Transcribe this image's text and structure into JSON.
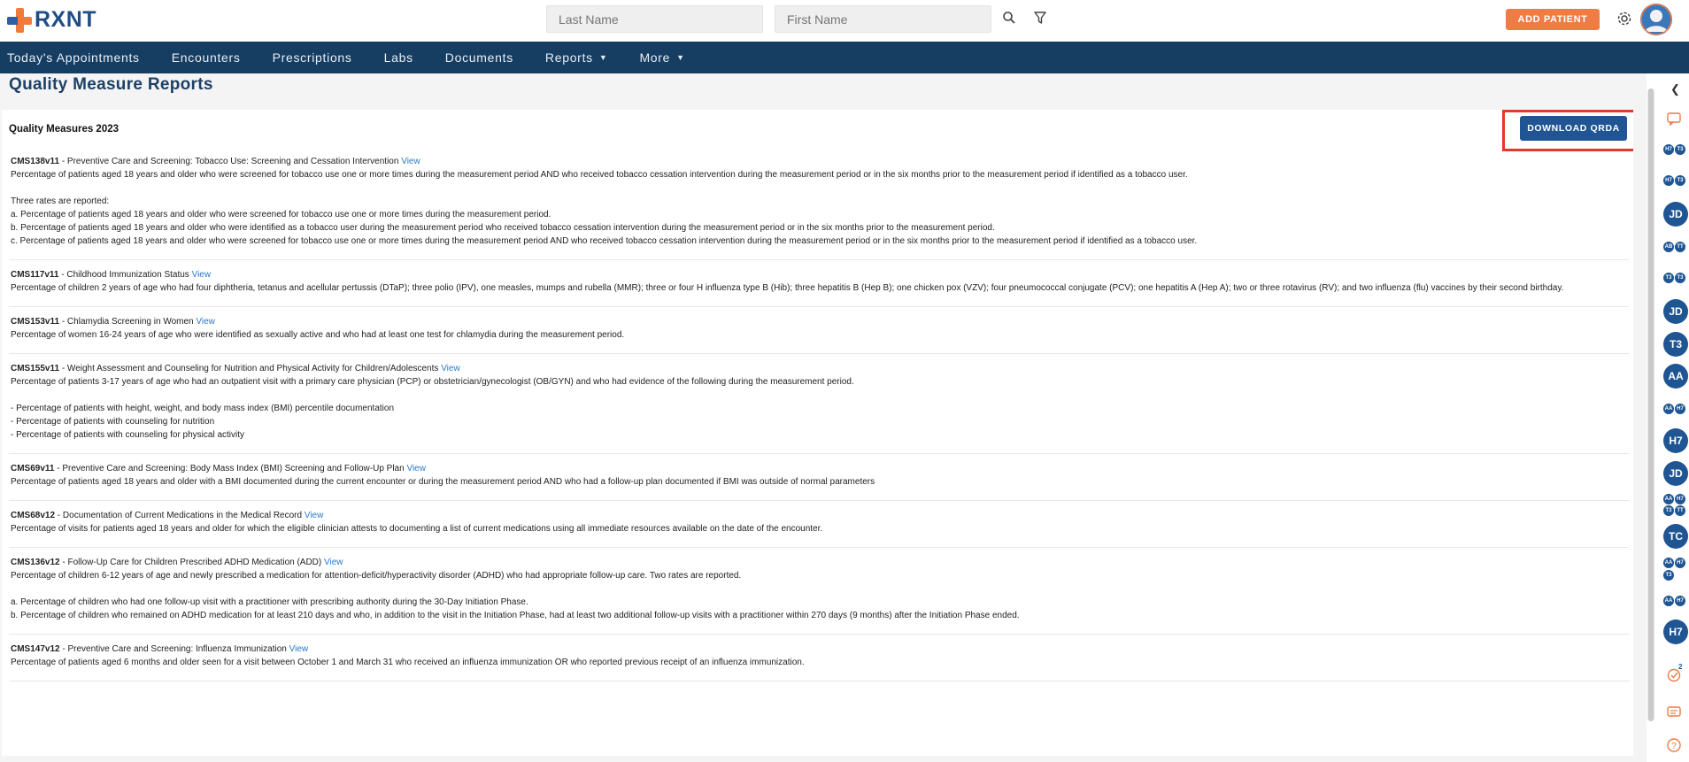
{
  "brand": {
    "name": "RXNT"
  },
  "header": {
    "last_name_placeholder": "Last Name",
    "first_name_placeholder": "First Name",
    "add_patient_label": "ADD PATIENT"
  },
  "nav": {
    "items": [
      {
        "label": "Today's Appointments"
      },
      {
        "label": "Encounters"
      },
      {
        "label": "Prescriptions"
      },
      {
        "label": "Labs"
      },
      {
        "label": "Documents"
      },
      {
        "label": "Reports"
      },
      {
        "label": "More"
      }
    ]
  },
  "page": {
    "title": "Quality Measure Reports",
    "section_title": "Quality Measures 2023",
    "download_label": "DOWNLOAD QRDA"
  },
  "measures": [
    {
      "code": "CMS138v11",
      "name": " - Preventive Care and Screening: Tobacco Use: Screening and Cessation Intervention ",
      "view": "View",
      "lines": [
        "Percentage of patients aged 18 years and older who were screened for tobacco use one or more times during the measurement period AND who received tobacco cessation intervention during the measurement period or in the six months prior to the measurement period if identified as a tobacco user.",
        "",
        "Three rates are reported:",
        "a. Percentage of patients aged 18 years and older who were screened for tobacco use one or more times during the measurement period.",
        "b. Percentage of patients aged 18 years and older who were identified as a tobacco user during the measurement period who received tobacco cessation intervention during the measurement period or in the six months prior to the measurement period.",
        "c. Percentage of patients aged 18 years and older who were screened for tobacco use one or more times during the measurement period AND who received tobacco cessation intervention during the measurement period or in the six months prior to the measurement period if identified as a tobacco user."
      ]
    },
    {
      "code": "CMS117v11",
      "name": " - Childhood Immunization Status ",
      "view": "View",
      "lines": [
        "Percentage of children 2 years of age who had four diphtheria, tetanus and acellular pertussis (DTaP); three polio (IPV), one measles, mumps and rubella (MMR); three or four H influenza type B (Hib); three hepatitis B (Hep B); one chicken pox (VZV); four pneumococcal conjugate (PCV); one hepatitis A (Hep A); two or three rotavirus (RV); and two influenza (flu) vaccines by their second birthday."
      ]
    },
    {
      "code": "CMS153v11",
      "name": " - Chlamydia Screening in Women ",
      "view": "View",
      "lines": [
        "Percentage of women 16-24 years of age who were identified as sexually active and who had at least one test for chlamydia during the measurement period."
      ]
    },
    {
      "code": "CMS155v11",
      "name": " - Weight Assessment and Counseling for Nutrition and Physical Activity for Children/Adolescents ",
      "view": "View",
      "lines": [
        "Percentage of patients 3-17 years of age who had an outpatient visit with a primary care physician (PCP) or obstetrician/gynecologist (OB/GYN) and who had evidence of the following during the measurement period.",
        "",
        "- Percentage of patients with height, weight, and body mass index (BMI) percentile documentation",
        "- Percentage of patients with counseling for nutrition",
        "- Percentage of patients with counseling for physical activity"
      ]
    },
    {
      "code": "CMS69v11",
      "name": " - Preventive Care and Screening: Body Mass Index (BMI) Screening and Follow-Up Plan ",
      "view": "View",
      "lines": [
        "Percentage of patients aged 18 years and older with a BMI documented during the current encounter or during the measurement period AND who had a follow-up plan documented if BMI was outside of normal parameters"
      ]
    },
    {
      "code": "CMS68v12",
      "name": " - Documentation of Current Medications in the Medical Record ",
      "view": "View",
      "lines": [
        "Percentage of visits for patients aged 18 years and older for which the eligible clinician attests to documenting a list of current medications using all immediate resources available on the date of the encounter."
      ]
    },
    {
      "code": "CMS136v12",
      "name": " - Follow-Up Care for Children Prescribed ADHD Medication (ADD) ",
      "view": "View",
      "lines": [
        "Percentage of children 6-12 years of age and newly prescribed a medication for attention-deficit/hyperactivity disorder (ADHD) who had appropriate follow-up care. Two rates are reported.",
        "",
        "a. Percentage of children who had one follow-up visit with a practitioner with prescribing authority during the 30-Day Initiation Phase.",
        "b. Percentage of children who remained on ADHD medication for at least 210 days and who, in addition to the visit in the Initiation Phase, had at least two additional follow-up visits with a practitioner within 270 days (9 months) after the Initiation Phase ended."
      ]
    },
    {
      "code": "CMS147v12",
      "name": " - Preventive Care and Screening: Influenza Immunization ",
      "view": "View",
      "lines": [
        "Percentage of patients aged 6 months and older seen for a visit between October 1 and March 31 who received an influenza immunization OR who reported previous receipt of an influenza immunization."
      ]
    }
  ],
  "rail": {
    "bubbles": [
      "JD",
      "JD",
      "T3",
      "AA",
      "H7",
      "JD",
      "TC",
      "H7"
    ],
    "pairs": [
      [
        "H7",
        "T3"
      ],
      [
        "H7",
        "T3"
      ],
      [
        "AB",
        "TT"
      ],
      [
        "T3",
        "T3"
      ],
      [
        "AA",
        "H7"
      ],
      [
        "AA",
        "H7"
      ],
      [
        "T3",
        "TT"
      ],
      [
        "AA",
        "H7"
      ],
      [
        "T3",
        ""
      ],
      [
        "AA",
        "H7"
      ]
    ],
    "badge_count": "2"
  },
  "colors": {
    "accent": "#ef7b45",
    "nav_bg": "#163d62",
    "primary": "#1f5592",
    "highlight": "#e23a2a",
    "link": "#2a7ac8"
  }
}
